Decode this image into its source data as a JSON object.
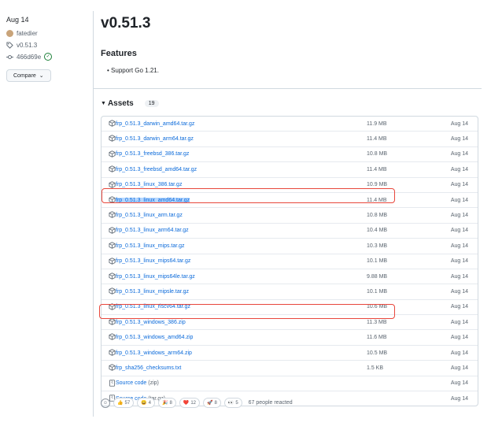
{
  "sidebar": {
    "date": "Aug 14",
    "author": "fatedier",
    "tag": "v0.51.3",
    "commit": "466d69e",
    "compare_label": "Compare"
  },
  "release": {
    "title": "v0.51.3",
    "features_heading": "Features",
    "features": [
      "Support Go 1.21."
    ]
  },
  "assets": {
    "heading": "Assets",
    "count": "19",
    "items": [
      {
        "name": "frp_0.51.3_darwin_amd64.tar.gz",
        "size": "11.9 MB",
        "date": "Aug 14"
      },
      {
        "name": "frp_0.51.3_darwin_arm64.tar.gz",
        "size": "11.4 MB",
        "date": "Aug 14"
      },
      {
        "name": "frp_0.51.3_freebsd_386.tar.gz",
        "size": "10.8 MB",
        "date": "Aug 14"
      },
      {
        "name": "frp_0.51.3_freebsd_amd64.tar.gz",
        "size": "11.4 MB",
        "date": "Aug 14"
      },
      {
        "name": "frp_0.51.3_linux_386.tar.gz",
        "size": "10.9 MB",
        "date": "Aug 14"
      },
      {
        "name": "frp_0.51.3_linux_amd64.tar.gz",
        "size": "11.4 MB",
        "date": "Aug 14"
      },
      {
        "name": "frp_0.51.3_linux_arm.tar.gz",
        "size": "10.8 MB",
        "date": "Aug 14"
      },
      {
        "name": "frp_0.51.3_linux_arm64.tar.gz",
        "size": "10.4 MB",
        "date": "Aug 14"
      },
      {
        "name": "frp_0.51.3_linux_mips.tar.gz",
        "size": "10.3 MB",
        "date": "Aug 14"
      },
      {
        "name": "frp_0.51.3_linux_mips64.tar.gz",
        "size": "10.1 MB",
        "date": "Aug 14"
      },
      {
        "name": "frp_0.51.3_linux_mips64le.tar.gz",
        "size": "9.88 MB",
        "date": "Aug 14"
      },
      {
        "name": "frp_0.51.3_linux_mipsle.tar.gz",
        "size": "10.1 MB",
        "date": "Aug 14"
      },
      {
        "name": "frp_0.51.3_linux_riscv64.tar.gz",
        "size": "10.6 MB",
        "date": "Aug 14"
      },
      {
        "name": "frp_0.51.3_windows_386.zip",
        "size": "11.3 MB",
        "date": "Aug 14"
      },
      {
        "name": "frp_0.51.3_windows_amd64.zip",
        "size": "11.6 MB",
        "date": "Aug 14"
      },
      {
        "name": "frp_0.51.3_windows_arm64.zip",
        "size": "10.5 MB",
        "date": "Aug 14"
      },
      {
        "name": "frp_sha256_checksums.txt",
        "size": "1.5 KB",
        "date": "Aug 14"
      }
    ],
    "source": [
      {
        "label": "Source code",
        "ext": "(zip)",
        "date": "Aug 14"
      },
      {
        "label": "Source code",
        "ext": "(tar.gz)",
        "date": "Aug 14"
      }
    ]
  },
  "reactions": {
    "items": [
      {
        "emoji": "👍",
        "count": "57"
      },
      {
        "emoji": "😄",
        "count": "4"
      },
      {
        "emoji": "🎉",
        "count": "8"
      },
      {
        "emoji": "❤️",
        "count": "12"
      },
      {
        "emoji": "🚀",
        "count": "8"
      },
      {
        "emoji": "👀",
        "count": "5"
      }
    ],
    "summary": "67 people reacted"
  },
  "colors": {
    "link": "#0969da",
    "highlight_border": "#e8473c",
    "selection": "#b6d7ff"
  }
}
